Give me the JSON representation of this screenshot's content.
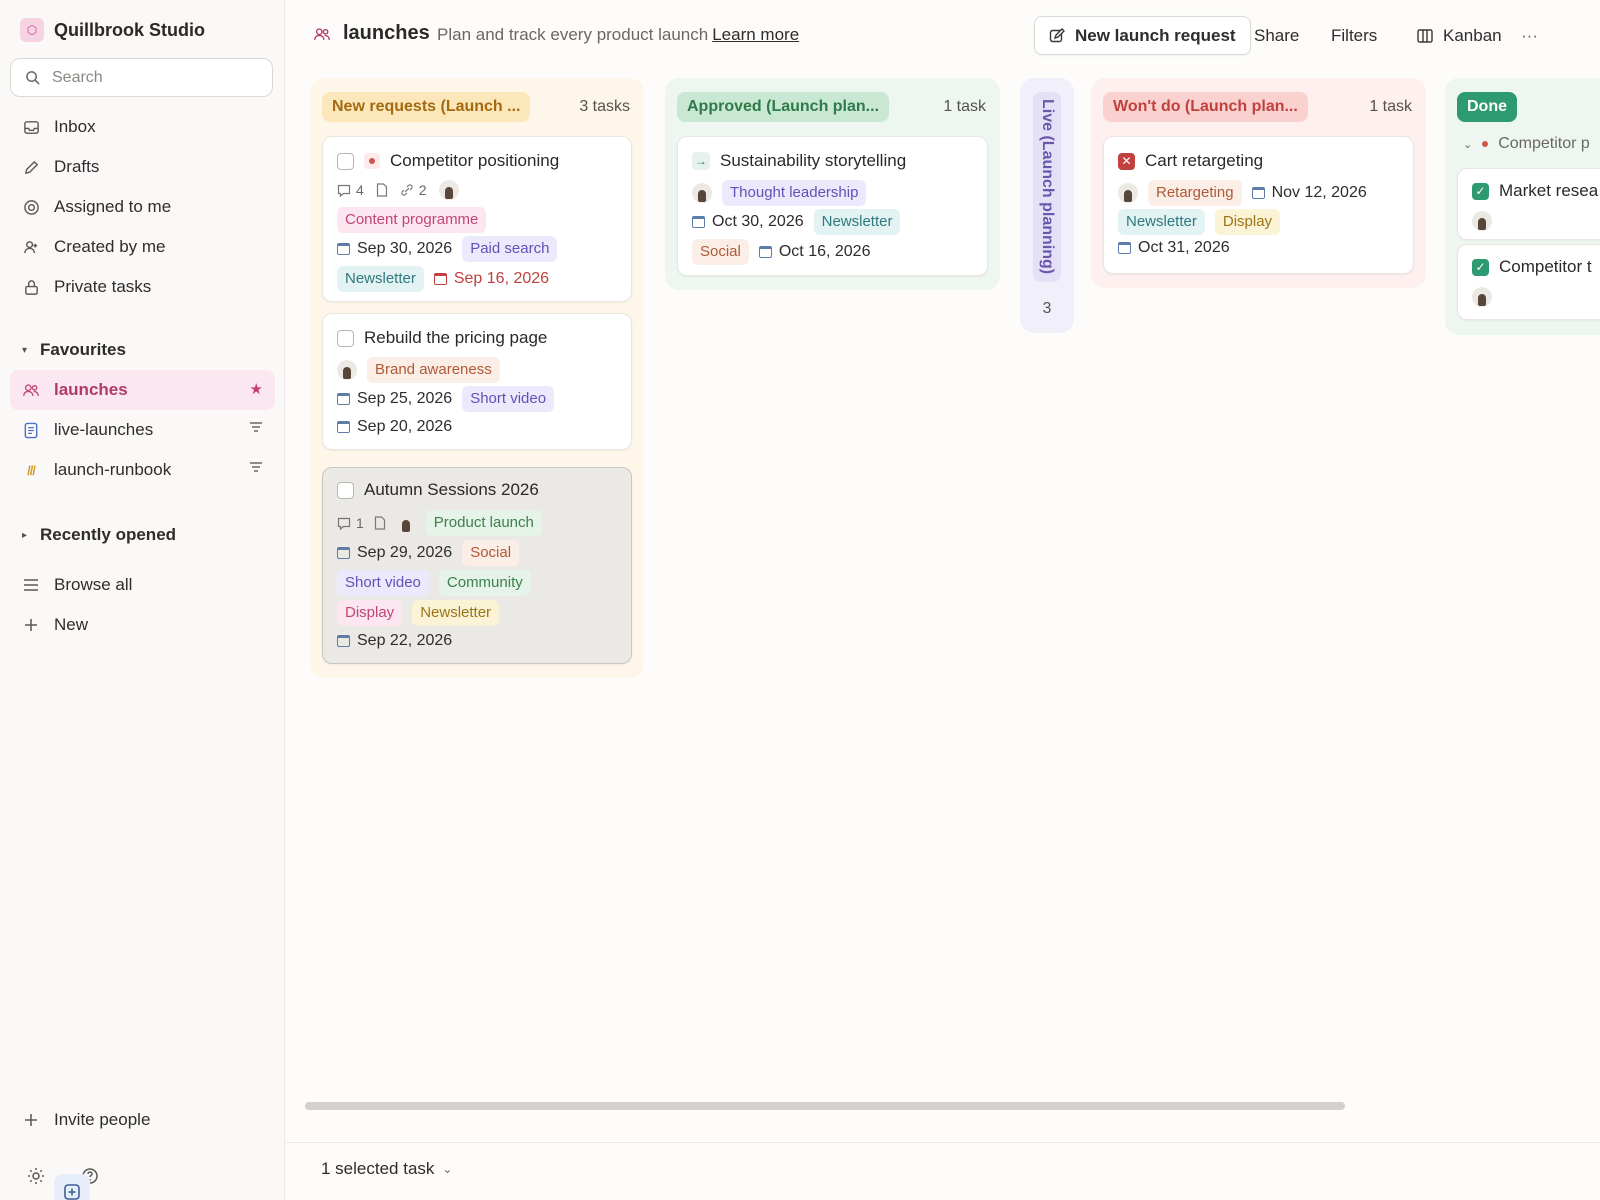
{
  "workspace": {
    "name": "Quillbrook Studio"
  },
  "search": {
    "placeholder": "Search"
  },
  "nav": [
    {
      "label": "Inbox",
      "icon": "inbox-icon"
    },
    {
      "label": "Drafts",
      "icon": "pencil-icon"
    },
    {
      "label": "Assigned to me",
      "icon": "target-icon"
    },
    {
      "label": "Created by me",
      "icon": "user-plus-icon"
    },
    {
      "label": "Private tasks",
      "icon": "lock-icon"
    }
  ],
  "favourites": {
    "label": "Favourites",
    "items": [
      {
        "label": "launches",
        "icon": "team-icon"
      },
      {
        "label": "live-launches",
        "icon": "document-icon"
      },
      {
        "label": "launch-runbook",
        "icon": "stripes-icon"
      }
    ]
  },
  "recently_opened": {
    "label": "Recently opened"
  },
  "browse_all": "Browse all",
  "new_label": "New",
  "invite": "Invite people",
  "page": {
    "title": "launches",
    "description": "Plan and track every product launch",
    "learn_more": "Learn more"
  },
  "toolbar": {
    "new_request": "New launch request",
    "share": "Share",
    "filters": "Filters",
    "view": "Kanban",
    "more": "···"
  },
  "columns": {
    "new": {
      "label": "New requests (Launch ...",
      "count": "3 tasks",
      "cards": [
        {
          "title": "Competitor positioning",
          "comments": "4",
          "links": "2",
          "tags": [
            "Content programme",
            "Paid search",
            "Newsletter"
          ],
          "dates": [
            "Sep 30, 2026",
            "Sep 16, 2026"
          ]
        },
        {
          "title": "Rebuild the pricing page",
          "tags": [
            "Brand awareness",
            "Short video"
          ],
          "dates": [
            "Sep 25, 2026",
            "Sep 20, 2026"
          ]
        },
        {
          "title": "Autumn Sessions 2026",
          "comments": "1",
          "tags": [
            "Product launch",
            "Social",
            "Short video",
            "Community",
            "Display",
            "Newsletter"
          ],
          "dates": [
            "Sep 29, 2026",
            "Sep 22, 2026"
          ]
        }
      ]
    },
    "approved": {
      "label": "Approved (Launch plan...",
      "count": "1 task",
      "cards": [
        {
          "title": "Sustainability storytelling",
          "tags": [
            "Thought leadership",
            "Newsletter",
            "Social"
          ],
          "dates": [
            "Oct 30, 2026",
            "Oct 16, 2026"
          ]
        }
      ]
    },
    "live": {
      "label": "Live (Launch planning)",
      "count": "3"
    },
    "wont": {
      "label": "Won't do (Launch plan...",
      "count": "1 task",
      "cards": [
        {
          "title": "Cart retargeting",
          "tags": [
            "Retargeting",
            "Newsletter",
            "Display"
          ],
          "dates": [
            "Nov 12, 2026",
            "Oct 31, 2026"
          ]
        }
      ]
    },
    "done": {
      "label": "Done",
      "group": "Competitor p",
      "cards": [
        {
          "title": "Market resea"
        },
        {
          "title": "Competitor t"
        }
      ]
    }
  },
  "footer": {
    "selected": "1 selected task"
  }
}
